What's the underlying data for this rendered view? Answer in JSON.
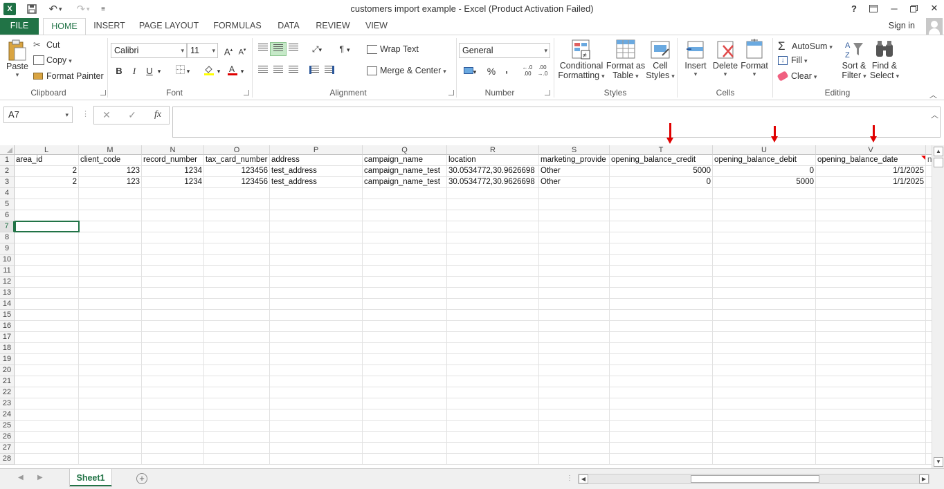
{
  "app": {
    "title": "customers import example - Excel (Product Activation Failed)",
    "logo": "X",
    "sign_in": "Sign in"
  },
  "tabs": [
    "FILE",
    "HOME",
    "INSERT",
    "PAGE LAYOUT",
    "FORMULAS",
    "DATA",
    "REVIEW",
    "VIEW"
  ],
  "active_tab": "HOME",
  "ribbon": {
    "clipboard": {
      "paste": "Paste",
      "cut": "Cut",
      "copy": "Copy",
      "format_painter": "Format Painter",
      "label": "Clipboard"
    },
    "font": {
      "name": "Calibri",
      "size": "11",
      "bold": "B",
      "italic": "I",
      "underline": "U",
      "grow": "A",
      "shrink": "A",
      "label": "Font"
    },
    "alignment": {
      "wrap_text": "Wrap Text",
      "merge_center": "Merge & Center",
      "label": "Alignment"
    },
    "number": {
      "format": "General",
      "percent": "%",
      "comma": ",",
      "inc_decimal": "←.0\n.00",
      "dec_decimal": ".00\n→.0",
      "label": "Number"
    },
    "styles": {
      "conditional_1": "Conditional",
      "conditional_2": "Formatting",
      "format_as_1": "Format as",
      "format_as_2": "Table",
      "cell_1": "Cell",
      "cell_2": "Styles",
      "label": "Styles"
    },
    "cells": {
      "insert": "Insert",
      "delete": "Delete",
      "format": "Format",
      "label": "Cells"
    },
    "editing": {
      "autosum": "AutoSum",
      "fill": "Fill",
      "clear": "Clear",
      "sort_1": "Sort &",
      "sort_2": "Filter",
      "find_1": "Find &",
      "find_2": "Select",
      "label": "Editing"
    }
  },
  "formula_bar": {
    "name_box": "A7",
    "cancel": "✕",
    "enter": "✓",
    "fx": "fx",
    "value": ""
  },
  "columns": [
    "L",
    "M",
    "N",
    "O",
    "P",
    "Q",
    "R",
    "S",
    "T",
    "U",
    "V"
  ],
  "rows": [
    "1",
    "2",
    "3",
    "4",
    "5",
    "6",
    "7",
    "8",
    "9",
    "10",
    "11",
    "12",
    "13",
    "14",
    "15",
    "16",
    "17",
    "18",
    "19",
    "20",
    "21",
    "22",
    "23",
    "24",
    "25",
    "26",
    "27",
    "28"
  ],
  "selected_row": "7",
  "cells": [
    [
      "area_id",
      "client_code",
      "record_number",
      "tax_card_number",
      "address",
      "campaign_name",
      "location",
      "marketing_provide",
      "opening_balance_credit",
      "opening_balance_debit",
      "opening_balance_date",
      "n"
    ],
    [
      "2",
      "123",
      "1234",
      "123456",
      "test_address",
      "campaign_name_test",
      "30.0534772,30.9626698",
      "Other",
      "5000",
      "0",
      "1/1/2025"
    ],
    [
      "2",
      "123",
      "1234",
      "123456",
      "test_address",
      "campaign_name_test",
      "30.0534772,30.9626698",
      "Other",
      "0",
      "5000",
      "1/1/2025"
    ]
  ],
  "sheets": [
    "Sheet1"
  ],
  "active_sheet": "Sheet1",
  "colors": {
    "accent": "#217346",
    "annotation": "#e00000"
  }
}
